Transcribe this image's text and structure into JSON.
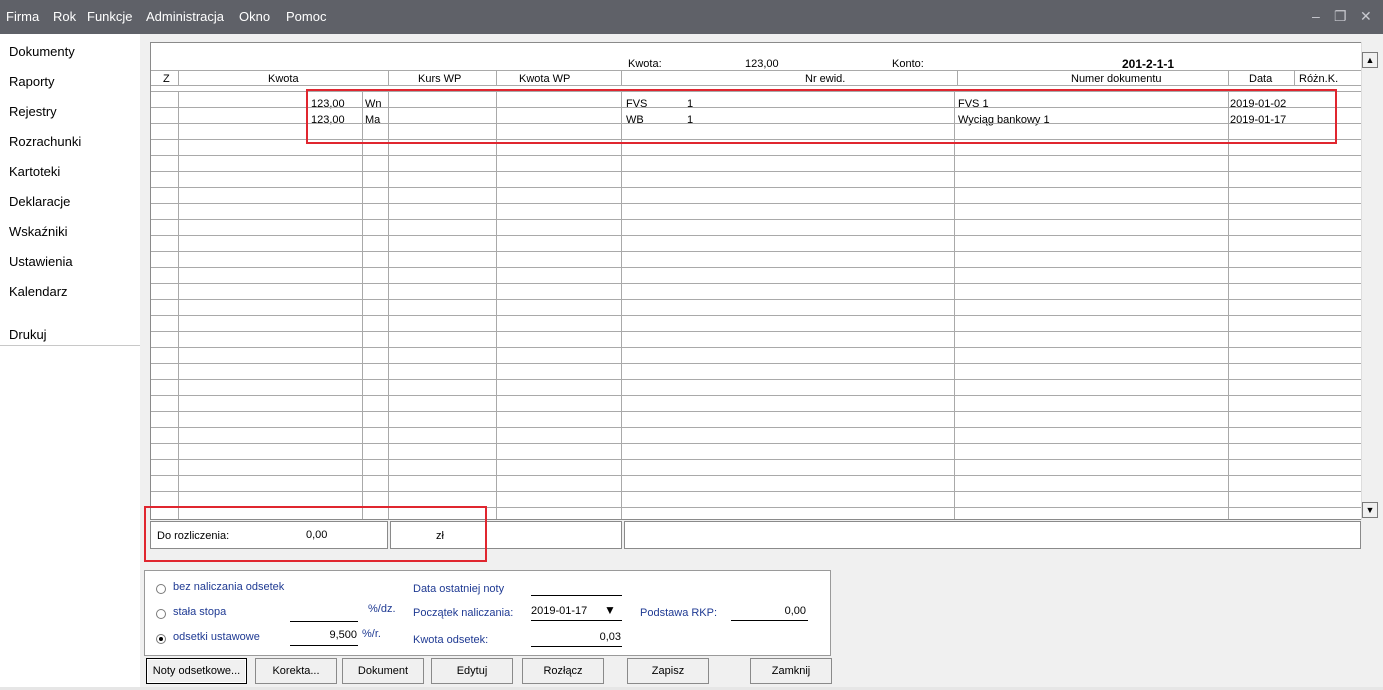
{
  "menu": {
    "items": [
      "Firma",
      "Rok",
      "Funkcje",
      "Administracja",
      "Okno",
      "Pomoc"
    ]
  },
  "sidebar": {
    "items": [
      "Dokumenty",
      "Raporty",
      "Rejestry",
      "Rozrachunki",
      "Kartoteki",
      "Deklaracje",
      "Wskaźniki",
      "Ustawienia",
      "Kalendarz"
    ],
    "print": "Drukuj"
  },
  "grid": {
    "info": {
      "kwota_label": "Kwota:",
      "kwota_value": "123,00",
      "konto_label": "Konto:",
      "konto_value": "201-2-1-1"
    },
    "columns": [
      "Z",
      "Kwota",
      "Kurs WP",
      "Kwota WP",
      "Nr ewid.",
      "Numer dokumentu",
      "Data",
      "Różn.K."
    ],
    "rows": [
      {
        "kwota": "123,00",
        "side": "Wn",
        "nr_prefix": "FVS",
        "nr_num": "1",
        "numer": "FVS 1",
        "data": "2019-01-02"
      },
      {
        "kwota": "123,00",
        "side": "Ma",
        "nr_prefix": "WB",
        "nr_num": "1",
        "numer": "Wyciąg bankowy 1",
        "data": "2019-01-17"
      }
    ]
  },
  "summary": {
    "label": "Do rozliczenia:",
    "value": "0,00",
    "currency": "zł"
  },
  "interest": {
    "option_none": "bez naliczania odsetek",
    "option_fixed": "stała stopa",
    "fixed_unit": "%/dz.",
    "option_statutory": "odsetki ustawowe",
    "statutory_value": "9,500",
    "statutory_unit": "%/r.",
    "selected": "odsetki ustawowe",
    "last_note_label": "Data ostatniej noty",
    "start_label": "Początek naliczania:",
    "start_value": "2019-01-17",
    "amount_label": "Kwota odsetek:",
    "amount_value": "0,03",
    "base_label": "Podstawa RKP:",
    "base_value": "0,00"
  },
  "buttons": [
    "Noty odsetkowe...",
    "Korekta...",
    "Dokument",
    "Edytuj",
    "Rozłącz",
    "Zapisz",
    "Zamknij"
  ],
  "colors": {
    "menubar": "#5f6168",
    "highlight": "#e0262f",
    "label_blue": "#1f3a93"
  }
}
